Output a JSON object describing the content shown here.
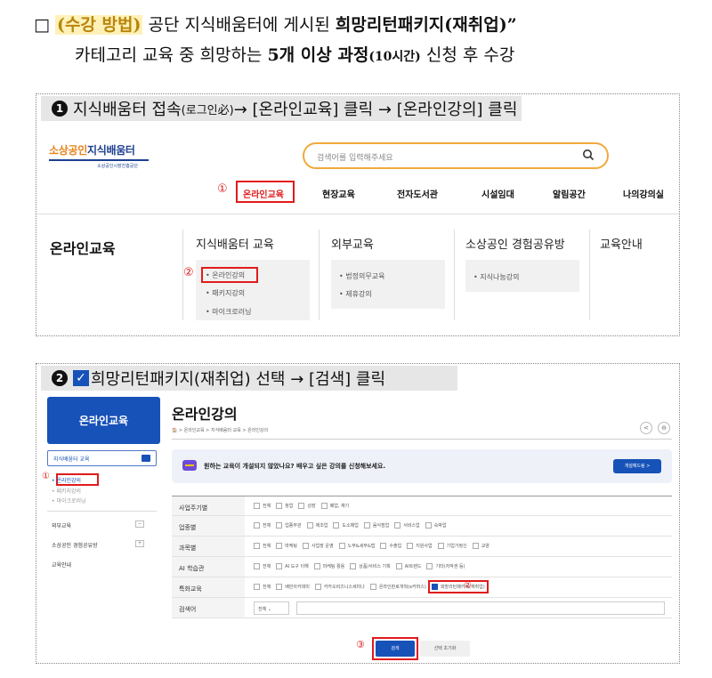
{
  "header": {
    "checkbox_glyph": "□",
    "method_label": "(수강 방법)",
    "line1_text": " 공단 지식배움터에 게시된 ",
    "package_name": "희망리턴패키지(재취업)”",
    "line2_a": "카테고리 교육 중 희망하는 ",
    "line2_count": "5개 이상 과정",
    "line2_hours": "(10시간)",
    "line2_b": " 신청 후 수강"
  },
  "step1": {
    "number": "1",
    "text_a": "지식배움터 접속",
    "text_small": "(로그인必)",
    "text_b": " → [온라인교육] 클릭 → [온라인강의] 클릭",
    "logo_main_a": "소상공인",
    "logo_main_b": "지식배움터",
    "logo_sub": "소상공인시장진흥공단",
    "search_placeholder": "검색어를 입력해주세요",
    "search_icon": "Q",
    "marker1": "①",
    "marker2": "②",
    "nav": [
      "온라인교육",
      "현장교육",
      "전자도서관",
      "시설임대",
      "알림공간",
      "나의강의실"
    ],
    "menu_title": "온라인교육",
    "columns": [
      {
        "title": "지식배움터 교육",
        "items": [
          "온라인강의",
          "패키지강의",
          "마이크로러닝"
        ]
      },
      {
        "title": "외부교육",
        "items": [
          "법정의무교육",
          "제휴강의"
        ]
      },
      {
        "title": "소상공인 경험공유방",
        "items": [
          "지식나눔강의"
        ]
      },
      {
        "title": "교육안내",
        "items": []
      }
    ]
  },
  "step2": {
    "number": "2",
    "check_glyph": "✓",
    "text_a": "희망리턴패키지(재취업) 선택 → [검색] 클릭",
    "side_title": "온라인교육",
    "side_selected": "지식배움터 교육",
    "side_items": [
      "온라인강의",
      "패키지강의",
      "마이크로러닝"
    ],
    "side_groups": [
      "외부교육",
      "소상공인 경험공유방",
      "교육안내"
    ],
    "plus_glyph": "+",
    "minus_glyph": "−",
    "page_title": "온라인강의",
    "breadcrumb": "🏠 > 온라인교육 > 지식배움터 교육 > 온라인강의",
    "share_glyph": "<",
    "print_glyph": "⊖",
    "notice_text": "원하는 교육이 개설되지 않았나요? 배우고 싶은 강의를 신청해보세요.",
    "notice_button": "개설예드림 >",
    "marker1": "①",
    "marker2": "②",
    "marker3": "③",
    "filters": [
      {
        "label": "사업주기별",
        "options": [
          "전체",
          "창업",
          "성장",
          "폐업, 재기"
        ]
      },
      {
        "label": "업종별",
        "options": [
          "전체",
          "업종무관",
          "제조업",
          "도소매업",
          "음식점업",
          "서비스업",
          "숙박업"
        ]
      },
      {
        "label": "과목별",
        "options": [
          "전체",
          "마케팅",
          "사업장 운영",
          "노무&세무&법",
          "수출입",
          "지원사업",
          "기업가정신",
          "교양"
        ]
      },
      {
        "label": "AI 학습관",
        "options": [
          "전체",
          "AI 도구 이해",
          "마케팅 활용",
          "상품/서비스 기획",
          "AI트렌드",
          "기타(저작권 등)"
        ]
      },
      {
        "label": "특화교육",
        "options": [
          "전체",
          "배민아카데미",
          "카카오비즈니스세미나",
          "온라인판로개척(e커머스)",
          "희망리턴패키지(재취업)"
        ]
      }
    ],
    "keyword_label": "검색어",
    "keyword_select": "전체",
    "search_button": "검색",
    "reset_button": "선택 초기화"
  },
  "colors": {
    "accent_blue": "#1752b8",
    "marker_red": "#e01b1b",
    "highlight_yellow": "#fff1b8"
  }
}
